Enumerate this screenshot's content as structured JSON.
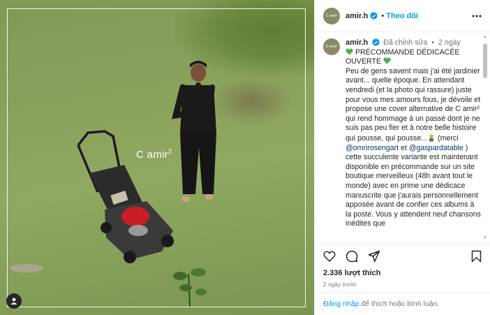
{
  "photo": {
    "album_title": "C amir",
    "album_title_sup": "2",
    "user_tag_icon": "user-tag-icon"
  },
  "header": {
    "avatar_text": "C amir²",
    "username": "amir.h",
    "separator": "•",
    "follow_label": "Theo dõi",
    "verified_icon": "verified-badge-icon",
    "more_icon": "more-options-icon"
  },
  "caption": {
    "username": "amir.h",
    "edited_label": "Đã chỉnh sửa",
    "separator": "•",
    "time": "2 ngày",
    "line1": " PRÉCOMMANDE DÉDICACÉE OUVERTE ",
    "text_a": "Peu de gens savent mais j'ai été jardinier avant... quelle époque. En attendant vendredi (et la photo qui rassure) juste pour vous mes amours fous, je dévoile et propose une cover alternative de C amir² qui rend hommage à un passé dont je ne suis pas peu fier et à notre belle histoire qui pousse, qui pousse...",
    "text_b": " (merci ",
    "mention1": "@omrirosengart",
    "text_c": " et ",
    "mention2": "@gaspardatable",
    "text_d": " ) cette succulente variante est maintenant disponible en précommande sur un site boutique merveilleux (48h avant tout le monde) avec en prime une dédicace manuscrite que j'aurais personnellement apposée avant de confier ces albums à la poste. Vous y attendent neuf chansons inédites que"
  },
  "actions": {
    "like_icon": "heart-icon",
    "comment_icon": "comment-icon",
    "share_icon": "share-icon",
    "save_icon": "bookmark-icon",
    "likes": "2.336 lượt thích",
    "time_ago": "2 ngày trước"
  },
  "login": {
    "link": "Đăng nhập",
    "text": " để thích hoặc bình luận."
  },
  "colors": {
    "accent": "#0095f6",
    "mention": "#00376b",
    "heart_green": "#4caf50"
  }
}
